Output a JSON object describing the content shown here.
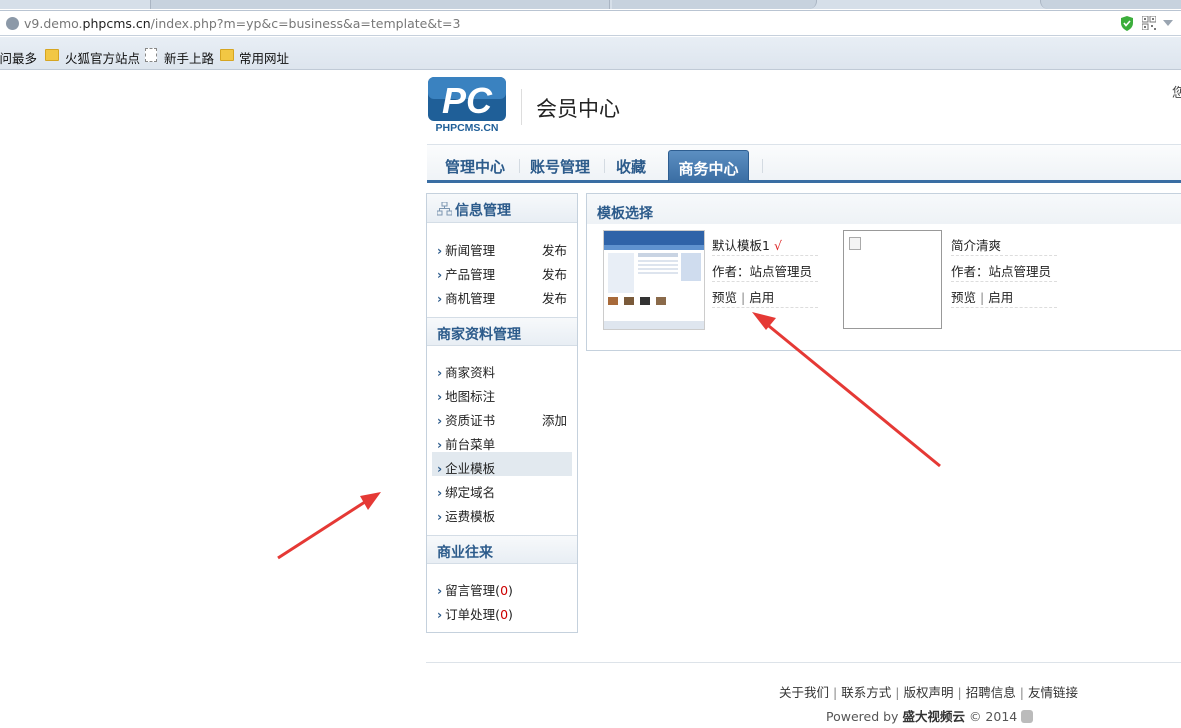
{
  "browser": {
    "url_prefix": "v9.demo.",
    "url_domain": "phpcms.cn",
    "url_path": "/index.php?m=yp&c=business&a=template&t=3",
    "bookmarks": [
      {
        "label": "访问最多",
        "icon": "bookmark-icon"
      },
      {
        "label": "火狐官方站点",
        "icon": "folder-icon"
      },
      {
        "label": "新手上路",
        "icon": "page-icon"
      },
      {
        "label": "常用网址",
        "icon": "folder-icon"
      }
    ]
  },
  "header": {
    "logo_text": "PC",
    "logo_sub": "PHPCMS.CN",
    "title": "会员中心",
    "corner_glyph": "您"
  },
  "nav": {
    "tabs": [
      {
        "label": "管理中心"
      },
      {
        "label": "账号管理"
      },
      {
        "label": "收藏"
      },
      {
        "label": "商务中心",
        "active": true
      }
    ],
    "accent": "#3b6ea4"
  },
  "sidebar": {
    "sections": [
      {
        "title": "信息管理",
        "items": [
          {
            "label": "新闻管理",
            "action": "发布"
          },
          {
            "label": "产品管理",
            "action": "发布"
          },
          {
            "label": "商机管理",
            "action": "发布"
          }
        ]
      },
      {
        "title": "商家资料管理",
        "items": [
          {
            "label": "商家资料"
          },
          {
            "label": "地图标注"
          },
          {
            "label": "资质证书",
            "action": "添加"
          },
          {
            "label": "前台菜单"
          },
          {
            "label": "企业模板",
            "selected": true
          },
          {
            "label": "绑定域名"
          },
          {
            "label": "运费模板"
          }
        ]
      },
      {
        "title": "商业往来",
        "items": [
          {
            "label": "留言管理",
            "count": "0"
          },
          {
            "label": "订单处理",
            "count": "0"
          }
        ]
      }
    ]
  },
  "main": {
    "title": "模板选择",
    "templates": [
      {
        "name": "默认模板1",
        "checked": "√",
        "author": "作者：站点管理员",
        "preview": "预览",
        "divider": "|",
        "enable": "启用"
      },
      {
        "name": "简介清爽",
        "author": "作者：站点管理员",
        "preview": "预览",
        "divider": "|",
        "enable": "启用"
      }
    ]
  },
  "footer": {
    "links": [
      "关于我们",
      "联系方式",
      "版权声明",
      "招聘信息",
      "友情链接"
    ],
    "powered_prefix": "Powered by",
    "powered_brand": "盛大视频云",
    "powered_suffix": "© 2014"
  }
}
